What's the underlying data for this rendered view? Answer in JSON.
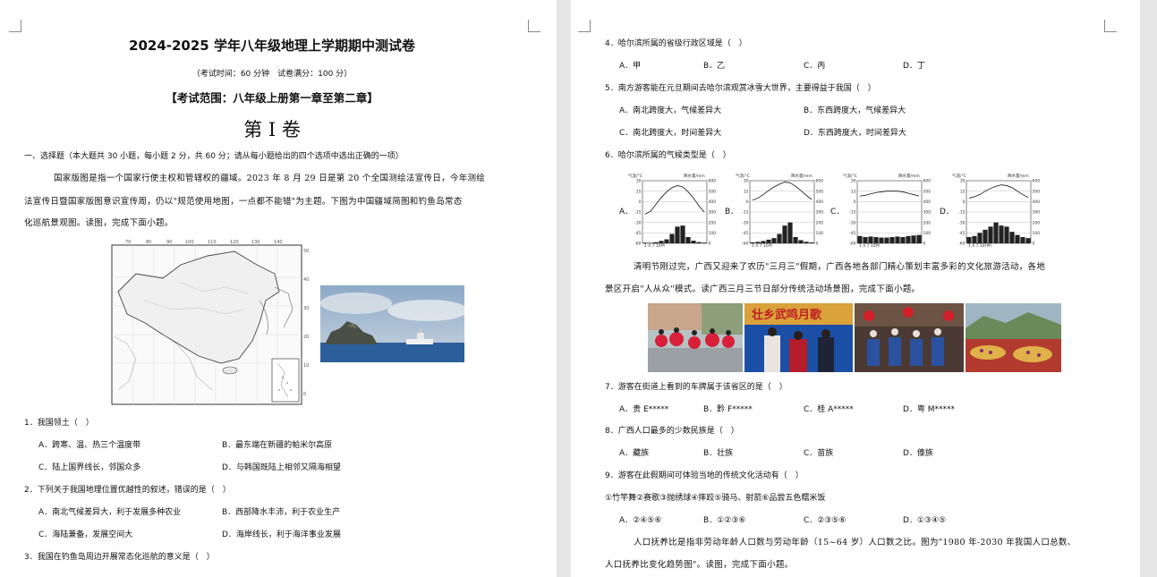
{
  "left": {
    "title": "2024-2025 学年八年级地理上学期期中测试卷",
    "subtitle": "（考试时间：60 分钟　试卷满分：100 分）",
    "scope": "【考试范围：八年级上册第一章至第二章】",
    "volume": "第 I 卷",
    "section": "一、选择题（本大题共 30 小题，每小题 2 分，共 60 分；请从每小题给出的四个选项中选出正确的一项）",
    "passage": [
      "国家版图是指一个国家行使主权和管辖权的疆域。2023 年 8 月 29 日是第 20 个全国测绘法宣传日，今年测绘",
      "法宣传日暨国家版图意识宣传周，仍以\"规范使用地图，一点都不能错\"为主题。下图为中国疆域简图和钓鱼岛常态",
      "化巡航景观图。读图，完成下面小题。"
    ],
    "map_lon_ticks": [
      "70",
      "80",
      "90",
      "100",
      "110",
      "120",
      "130",
      "140"
    ],
    "map_lat_ticks": [
      "50",
      "40",
      "30",
      "20",
      "10",
      "0"
    ],
    "questions": [
      {
        "stem": "1．我国领土（　）",
        "a": "A．跨寒、温、热三个温度带",
        "b": "B．最东端在新疆的帕米尔高原",
        "c": "C．陆上国界线长，邻国众多",
        "d": "D．与韩国既陆上相邻又隔海相望"
      },
      {
        "stem": "2．下列关于我国地理位置优越性的叙述，错误的是（　）",
        "a": "A．南北气候差异大，利于发展多种农业",
        "b": "B．西部降水丰沛，利于农业生产",
        "c": "C．海陆兼备，发展空间大",
        "d": "D．海岸线长，利于海洋事业发展"
      },
      {
        "stem": "3．我国在钓鱼岛周边开展常态化巡航的意义是（　）"
      }
    ]
  },
  "right": {
    "q4": {
      "stem": "4．哈尔滨所属的省级行政区域是（　）",
      "a": "A．甲",
      "b": "B．乙",
      "c": "C．丙",
      "d": "D．丁"
    },
    "q5": {
      "stem": "5．南方游客能在元旦期间去哈尔滨观赏冰雪大世界，主要得益于我国（　）",
      "a": "A．南北跨度大，气候差异大",
      "b": "B．东西跨度大，气候差异大",
      "c": "C．南北跨度大，时间差异大",
      "d": "D．东西跨度大，时间差异大"
    },
    "q6": {
      "stem": "6．哈尔滨所属的气候类型是（　）"
    },
    "climate_labels": [
      "A．",
      "B．",
      "C．",
      "D．"
    ],
    "climate_axis": {
      "temp": "气温/°C",
      "precip": "降水量/mm",
      "temp_ticks": [
        "30",
        "15",
        "0",
        "-15",
        "-30",
        "-45",
        "-60"
      ],
      "precip_ticks": [
        "600",
        "500",
        "400",
        "300",
        "200",
        "100",
        "0"
      ],
      "months_a": "1   4   7  10月",
      "months_d": "1  4  7  10(月)"
    },
    "passage2": [
      "清明节刚过完，广西又迎来了农历\"三月三\"假期，广西各地各部门精心策划丰富多彩的文化旅游活动，各地",
      "景区开启\"人从众\"模式。读广西三月三节日部分传统活动场景图，完成下面小题。"
    ],
    "photo_banner": "壮乡武鸣月歌",
    "q7": {
      "stem": "7．游客在街道上看到的车牌属于该省区的是（　）",
      "a": "A．贵 E*****",
      "b": "B．黔 F*****",
      "c": "C．桂 A*****",
      "d": "D．粤 M*****"
    },
    "q8": {
      "stem": "8．广西人口最多的少数民族是（　）",
      "a": "A．藏族",
      "b": "B．壮族",
      "c": "C．苗族",
      "d": "D．傣族"
    },
    "q9": {
      "stem": "9．游客在此假期间可体验当地的传统文化活动有（　）",
      "items": "①竹竿舞②赛歌③抛绣球④摔跤⑤骑马、射箭⑥品尝五色糯米饭",
      "a": "A．②④⑤⑥",
      "b": "B．①②③⑥",
      "c": "C．②③⑤⑥",
      "d": "D．①③④⑤"
    },
    "passage3": [
      "人口抚养比是指非劳动年龄人口数与劳动年龄（15~64 岁）人口数之比。图为\"1980 年-2030 年我国人口总数、",
      "人口抚养比变化趋势图\"。读图，完成下面小题。"
    ]
  },
  "climate_charts": [
    {
      "label": "A",
      "temps": [
        -18,
        -14,
        -4,
        6,
        14,
        20,
        23,
        21,
        14,
        5,
        -6,
        -15
      ],
      "precip": [
        6,
        5,
        11,
        23,
        38,
        90,
        160,
        170,
        60,
        25,
        12,
        7
      ]
    },
    {
      "label": "B",
      "temps": [
        2,
        5,
        10,
        16,
        21,
        25,
        28,
        27,
        22,
        16,
        9,
        3
      ],
      "precip": [
        10,
        14,
        22,
        35,
        50,
        90,
        170,
        200,
        60,
        30,
        15,
        8
      ]
    },
    {
      "label": "C",
      "temps": [
        8,
        9,
        11,
        13,
        14,
        15,
        15,
        15,
        14,
        12,
        10,
        8
      ],
      "precip": [
        70,
        60,
        65,
        60,
        55,
        55,
        60,
        65,
        60,
        70,
        75,
        80
      ]
    },
    {
      "label": "D",
      "temps": [
        5,
        7,
        10,
        15,
        19,
        22,
        24,
        23,
        20,
        15,
        10,
        6
      ],
      "precip": [
        60,
        70,
        100,
        130,
        160,
        200,
        170,
        160,
        110,
        80,
        60,
        50
      ]
    }
  ],
  "colors": {
    "page": "#ffffff",
    "background": "#e6e6e6",
    "text": "#111111"
  }
}
